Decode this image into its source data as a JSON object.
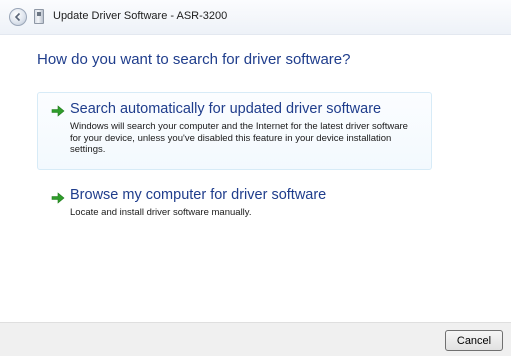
{
  "window": {
    "title": "Update Driver Software - ASR-3200"
  },
  "main": {
    "heading": "How do you want to search for driver software?",
    "options": [
      {
        "title": "Search automatically for updated driver software",
        "description_lines": [
          "Windows will search your computer and the Internet for the latest driver software",
          "for your device, unless you've disabled this feature in your device installation",
          "settings."
        ],
        "icon": "green-arrow-icon"
      },
      {
        "title": "Browse my computer for driver software",
        "description_lines": [
          "Locate and install driver software manually."
        ],
        "icon": "green-arrow-icon"
      }
    ]
  },
  "footer": {
    "cancel_label": "Cancel"
  },
  "colors": {
    "heading": "#1f3d8c",
    "arrow": "#2f9d2b",
    "footer_bg": "#f0f0f0"
  }
}
